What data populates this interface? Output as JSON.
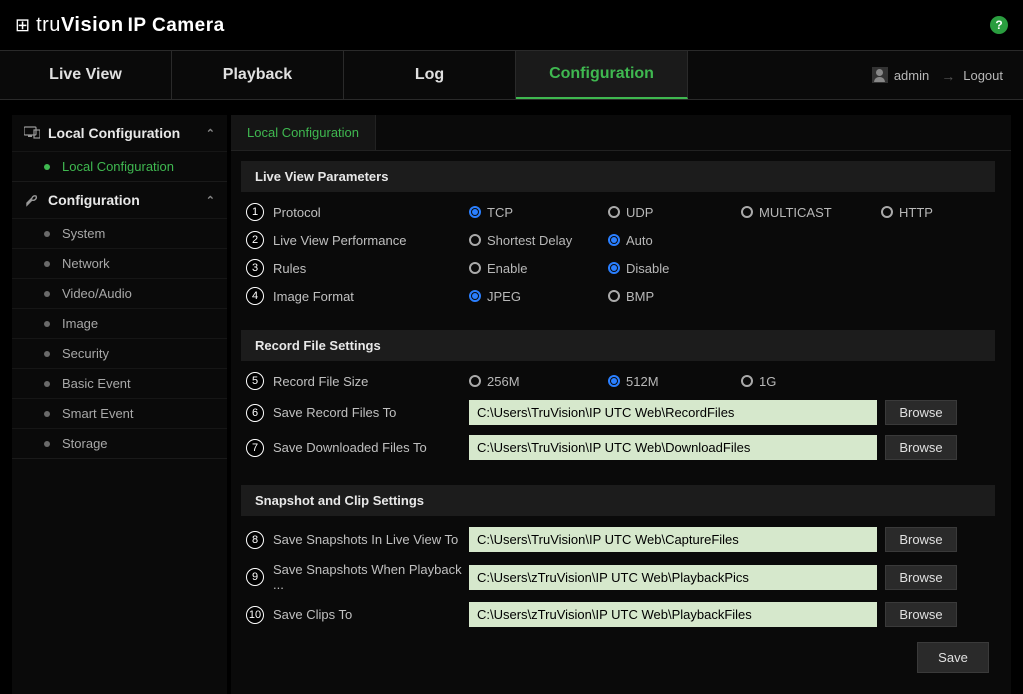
{
  "brand": {
    "prefix": "tru",
    "main": "Vision",
    "product": "IP Camera"
  },
  "help_symbol": "?",
  "nav": {
    "tabs": [
      "Live View",
      "Playback",
      "Log",
      "Configuration"
    ],
    "active_index": 3,
    "user": "admin",
    "logout": "Logout"
  },
  "sidebar": {
    "groups": [
      {
        "title": "Local Configuration",
        "items": [
          {
            "label": "Local Configuration",
            "active": true
          }
        ]
      },
      {
        "title": "Configuration",
        "items": [
          {
            "label": "System"
          },
          {
            "label": "Network"
          },
          {
            "label": "Video/Audio"
          },
          {
            "label": "Image"
          },
          {
            "label": "Security"
          },
          {
            "label": "Basic Event"
          },
          {
            "label": "Smart Event"
          },
          {
            "label": "Storage"
          }
        ]
      }
    ]
  },
  "content": {
    "tab_label": "Local Configuration",
    "sections": {
      "live_view": {
        "title": "Live View Parameters",
        "rows": [
          {
            "num": "1",
            "label": "Protocol",
            "options": [
              "TCP",
              "UDP",
              "MULTICAST",
              "HTTP"
            ],
            "selected": 0
          },
          {
            "num": "2",
            "label": "Live View Performance",
            "options": [
              "Shortest Delay",
              "Auto"
            ],
            "selected": 1
          },
          {
            "num": "3",
            "label": "Rules",
            "options": [
              "Enable",
              "Disable"
            ],
            "selected": 1
          },
          {
            "num": "4",
            "label": "Image Format",
            "options": [
              "JPEG",
              "BMP"
            ],
            "selected": 0
          }
        ]
      },
      "record": {
        "title": "Record File Settings",
        "size_row": {
          "num": "5",
          "label": "Record File Size",
          "options": [
            "256M",
            "512M",
            "1G"
          ],
          "selected": 1
        },
        "paths": [
          {
            "num": "6",
            "label": "Save Record Files To",
            "value": "C:\\Users\\TruVision\\IP UTC Web\\RecordFiles"
          },
          {
            "num": "7",
            "label": "Save Downloaded Files To",
            "value": "C:\\Users\\TruVision\\IP UTC Web\\DownloadFiles"
          }
        ]
      },
      "snapshot": {
        "title": "Snapshot and Clip Settings",
        "paths": [
          {
            "num": "8",
            "label": "Save Snapshots In Live View To",
            "value": "C:\\Users\\TruVision\\IP UTC Web\\CaptureFiles"
          },
          {
            "num": "9",
            "label": "Save Snapshots When Playback ...",
            "value": "C:\\Users\\zTruVision\\IP UTC Web\\PlaybackPics"
          },
          {
            "num": "10",
            "label": "Save Clips To",
            "value": "C:\\Users\\zTruVision\\IP UTC Web\\PlaybackFiles"
          }
        ]
      }
    },
    "browse_label": "Browse",
    "save_label": "Save"
  }
}
